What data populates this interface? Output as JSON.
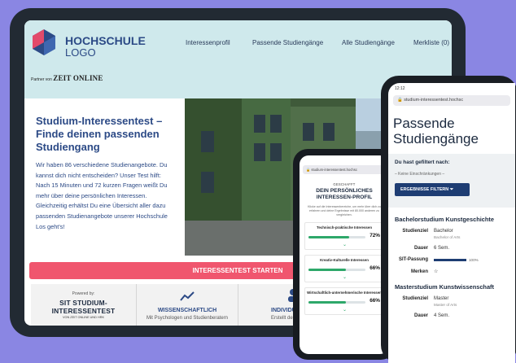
{
  "tablet": {
    "logo_line1": "HOCHSCHULE",
    "logo_line2": "LOGO",
    "partner_prefix": "Partner von",
    "partner_name": "ZEIT ONLINE",
    "nav": [
      "Interessenprofil",
      "Passende Studiengänge",
      "Alle Studiengänge",
      "Merkliste (0)"
    ],
    "hero_title": "Studium-Interessentest – Finde deinen passenden Studiengang",
    "hero_body": "Wir haben 86 verschiedene Studienangebote. Du kannst dich nicht entscheiden? Unser Test hilft: Nach 15 Minuten und 72 kurzen Fragen weißt Du mehr über deine persönlichen Interessen. Gleichzeitig erhältst Du eine Übersicht aller dazu passenden Studienangebote unserer Hochschule Los geht's!",
    "cta_label": "INTERESSENTEST STARTEN",
    "powered_by": "Powered by:",
    "sit_logo": "SIT STUDIUM-INTERESSENTEST",
    "sit_sub": "VON ZEIT ONLINE UND HRK",
    "feature_mid_title": "WISSENSCHAFTLICH",
    "feature_mid_sub": "Mit Psychologen und Studienberatern",
    "feature_right_title": "INDIVIDU",
    "feature_right_sub": "Erstellt dein pers"
  },
  "phone_mid": {
    "url": "studium-interessentest.hochsc",
    "kicker": "GESCHAFFT",
    "title": "DEIN PERSÖNLICHES INTERESSEN-PROFIL",
    "desc": "Klicke auf die Interessenbereiche, um mehr über dich zu erfahren und deine Ergebnisse mit 80.000 anderen zu vergleichen.",
    "cards": [
      {
        "label": "Technisch-praktische Interessen",
        "percent": "72%",
        "value": 0.72
      },
      {
        "label": "Kreativ-Kulturelle Interessen",
        "percent": "66%",
        "value": 0.66
      },
      {
        "label": "Wirtschaftlich-unternehmerische Interessen",
        "percent": "66%",
        "value": 0.66
      }
    ]
  },
  "phone_right": {
    "time": "12:12",
    "url": "studium-interessentest.hochsc",
    "title": "Passende Studiengänge",
    "filter_label": "Du hast gefiltert nach:",
    "filter_none": "– Keine Einschränkungen –",
    "filter_button": "ERGEBNISSE FILTERN",
    "section1": "Bachelorstudium Kunstgeschichte",
    "s1_rows": {
      "studienziel_key": "Studienziel",
      "studienziel_val": "Bachelor",
      "studienziel_sub": "Bachelor of Arts",
      "dauer_key": "Dauer",
      "dauer_val": "6 Sem.",
      "fit_key": "SIT-Passung",
      "fit_val": "100%",
      "merken_key": "Merken"
    },
    "section2": "Masterstudium Kunstwissenschaft",
    "s2_rows": {
      "studienziel_key": "Studienziel",
      "studienziel_val": "Master",
      "studienziel_sub": "Master of Arts",
      "dauer_key": "Dauer",
      "dauer_val": "4 Sem."
    }
  }
}
